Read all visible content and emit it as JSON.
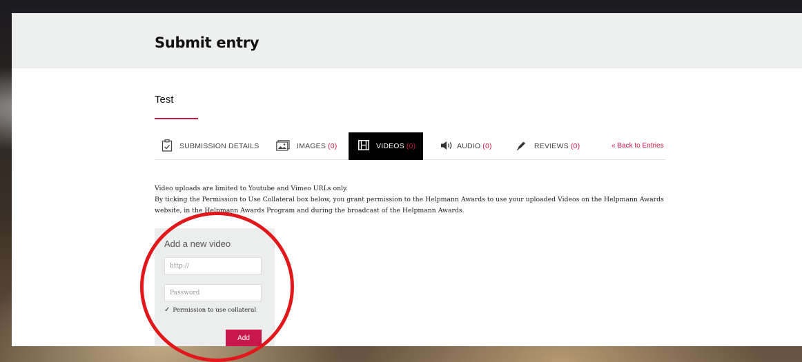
{
  "header": {
    "title": "Submit entry"
  },
  "entry": {
    "name": "Test"
  },
  "tabs": [
    {
      "label": "SUBMISSION DETAILS",
      "count": "",
      "icon": "clipboard-check-icon"
    },
    {
      "label": "IMAGES",
      "count": "(0)",
      "icon": "image-gallery-icon"
    },
    {
      "label": "VIDEOS",
      "count": "(0)",
      "icon": "film-icon",
      "active": true
    },
    {
      "label": "AUDIO",
      "count": "(0)",
      "icon": "speaker-icon"
    },
    {
      "label": "REVIEWS",
      "count": "(0)",
      "icon": "pen-icon"
    }
  ],
  "back_link": "« Back to Entries",
  "notice": {
    "line1": "Video uploads are limited to Youtube and Vimeo URLs only.",
    "line2": "By ticking the Permission to Use Collateral box below, you grant permission to the Helpmann Awards to use your uploaded Videos on the Helpmann Awards website, in the Helpmann Awards Program and during the broadcast of the Helpmann Awards."
  },
  "add_video": {
    "title": "Add a new video",
    "url_placeholder": "http://",
    "password_placeholder": "Password",
    "permission_label": "Permission to use collateral",
    "permission_checked": true,
    "add_label": "Add"
  },
  "colors": {
    "accent": "#c8174a",
    "annotation": "#e0181c"
  }
}
